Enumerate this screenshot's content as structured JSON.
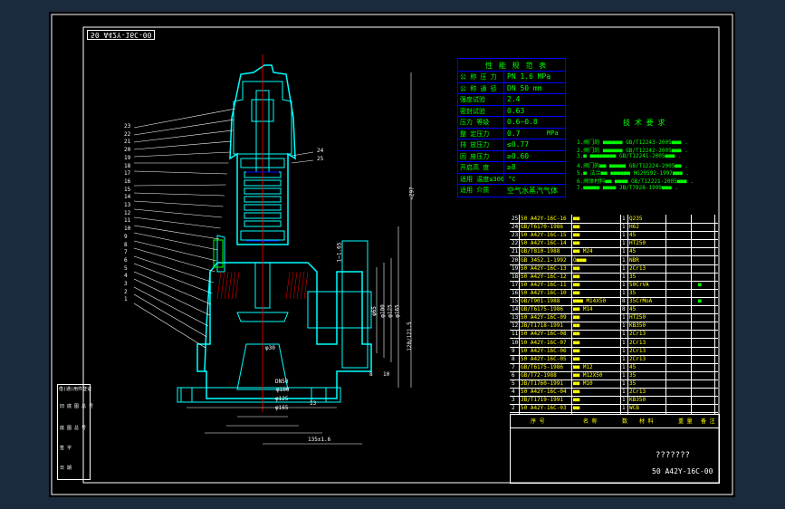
{
  "colors": {
    "background": "#1c2a3d",
    "paper": "#000000",
    "white": "#ffffff",
    "cyan": "#00ffff",
    "green": "#00ff00",
    "yellow": "#ffff00",
    "blue": "#0000ff",
    "red": "#ff0000"
  },
  "drawing_id_mirrored": "50 A42Y-16C-00",
  "perf_table": {
    "title": "性 能 规 范 表",
    "rows": [
      {
        "label": "公 称 压 力",
        "value": "PN  1.6  MPa"
      },
      {
        "label": "公 称 通 径",
        "value": "DN  50  mm"
      },
      {
        "label": "强度试验",
        "value": "2.4"
      },
      {
        "label": "密封试验",
        "value": "0.63"
      },
      {
        "label": "压力 等级",
        "value": "0.6~0.8"
      },
      {
        "label": "整 定压力",
        "value": "0.7",
        "unit": "MPa"
      },
      {
        "label": "排 放压力",
        "value": "≤0.77"
      },
      {
        "label": "回 座压力",
        "value": "≥0.60"
      },
      {
        "label": "开启高 度",
        "value": "≥8"
      },
      {
        "label": "适用 温度≤300 °C",
        "value": ""
      },
      {
        "label": "适用 介质",
        "value": "空气水蒸汽气体"
      }
    ]
  },
  "tech_req": {
    "title": "技 术 要 求",
    "lines": [
      "1.阀门的 ■■■■■■ GB/T12243-2005■■■ .",
      "2.阀门的 ■■■■■■ GB/T12242-2005■■■ .",
      "3.■ ■■■■■■■■ GB/T12241-2005■■■ .",
      "4.阀门的■■ ■■■■■ GB/T12224-2005■■ .",
      "5.■ 法兰■■ ■■■■■■ HG20592-1997■■■ .",
      "6.阀体材料■■ ■■■■ GB/T12221-2005■■■ .",
      "7.■■■■■ ■■■■ JB/T7928-1999■■■ ."
    ]
  },
  "part_numbers_left": [
    "23",
    "22",
    "21",
    "20",
    "19",
    "18",
    "17",
    "16",
    "15",
    "14",
    "13",
    "12",
    "11",
    "10",
    "9",
    "8",
    "7",
    "6",
    "5",
    "4",
    "3",
    "2",
    "1"
  ],
  "part_numbers_right": [
    "24",
    "25"
  ],
  "dims": {
    "overall_height": "≈297",
    "height_2": "120/121.5",
    "flange_dia": "DN50",
    "d_100": "φ100",
    "d_125": "φ125",
    "d_165": "φ165",
    "right_offset": "135±1.6",
    "nozzle": "φ30",
    "side_dims": [
      "φ65",
      "φ100",
      "φ125",
      "φ165"
    ],
    "top_left_dim": "1~1.65",
    "bottom_num": "13",
    "small_dims": [
      "8",
      "10"
    ]
  },
  "bom": {
    "rows": [
      {
        "code": "50 A42Y-16C-16",
        "name": "■■",
        "qty": "1",
        "material": "Q235",
        "note": ""
      },
      {
        "code": "GB/T6170-1986",
        "name": "■■",
        "qty": "1",
        "material": "H62",
        "note": ""
      },
      {
        "code": "50 A42Y-16C-15",
        "name": "■■",
        "qty": "1",
        "material": "45",
        "note": ""
      },
      {
        "code": "50 A42Y-16C-14",
        "name": "■■",
        "qty": "1",
        "material": "HT250",
        "note": ""
      },
      {
        "code": "GB/T810-1988",
        "name": "■■ M24",
        "qty": "1",
        "material": "45",
        "note": ""
      },
      {
        "code": "GB 3452.1-1992",
        "name": "O■■■",
        "qty": "1",
        "material": "NBR",
        "note": ""
      },
      {
        "code": "50 A42Y-16C-13",
        "name": "■■",
        "qty": "1",
        "material": "2Cr13",
        "note": ""
      },
      {
        "code": "50 A42Y-16C-12",
        "name": "■■",
        "qty": "1",
        "material": "35",
        "note": ""
      },
      {
        "code": "50 A42Y-16C-11",
        "name": "■■",
        "qty": "1",
        "material": "50CrVA",
        "note": "■"
      },
      {
        "code": "50 A42Y-16C-10",
        "name": "■■",
        "qty": "1",
        "material": "35",
        "note": ""
      },
      {
        "code": "GB/T901-1988",
        "name": "■■■ M14X50",
        "qty": "8",
        "material": "35CrMoA",
        "note": "■"
      },
      {
        "code": "GB/T6175-1986",
        "name": "■■ M14",
        "qty": "8",
        "material": "45",
        "note": ""
      },
      {
        "code": "50 A42Y-16C-09",
        "name": "■■",
        "qty": "1",
        "material": "HT250",
        "note": ""
      },
      {
        "code": "JB/T1718-1991",
        "name": "■■",
        "qty": "1",
        "material": "KB350",
        "note": ""
      },
      {
        "code": "50 A42Y-16C-08",
        "name": "■■",
        "qty": "1",
        "material": "2Cr13",
        "note": ""
      },
      {
        "code": "50 A42Y-16C-07",
        "name": "■■",
        "qty": "1",
        "material": "2Cr13",
        "note": ""
      },
      {
        "code": "50 A42Y-16C-06",
        "name": "■■",
        "qty": "1",
        "material": "2Cr13",
        "note": ""
      },
      {
        "code": "50 A42Y-16C-05",
        "name": "■■",
        "qty": "1",
        "material": "2Cr13",
        "note": ""
      },
      {
        "code": "GB/T6175-1986",
        "name": "■■ M12",
        "qty": "1",
        "material": "45",
        "note": ""
      },
      {
        "code": "GB/T72-1988",
        "name": "■■ M12X50",
        "qty": "1",
        "material": "35",
        "note": ""
      },
      {
        "code": "JB/T1760-1991",
        "name": "■■ M10",
        "qty": "1",
        "material": "35",
        "note": ""
      },
      {
        "code": "50 A42Y-16C-04",
        "name": "■■",
        "qty": "1",
        "material": "2Cr13",
        "note": ""
      },
      {
        "code": "JB/T1719-1991",
        "name": "■■",
        "qty": "1",
        "material": "KB350",
        "note": ""
      },
      {
        "code": "50 A42Y-16C-03",
        "name": "■■",
        "qty": "1",
        "material": "WCB",
        "note": ""
      }
    ],
    "header": {
      "no": "序 号",
      "name": "名 称",
      "qty": "数",
      "material": "材 料",
      "weight": "重 量",
      "note": "备 注"
    }
  },
  "title_block": {
    "title_placeholder": "???????",
    "drawing_no": "50 A42Y-16C-00"
  },
  "left_stamp": {
    "title": "借(通)用件登记",
    "rows": [
      "旧 底 图 总 号",
      "底 图 总 号",
      "签 字",
      "日 期"
    ]
  }
}
